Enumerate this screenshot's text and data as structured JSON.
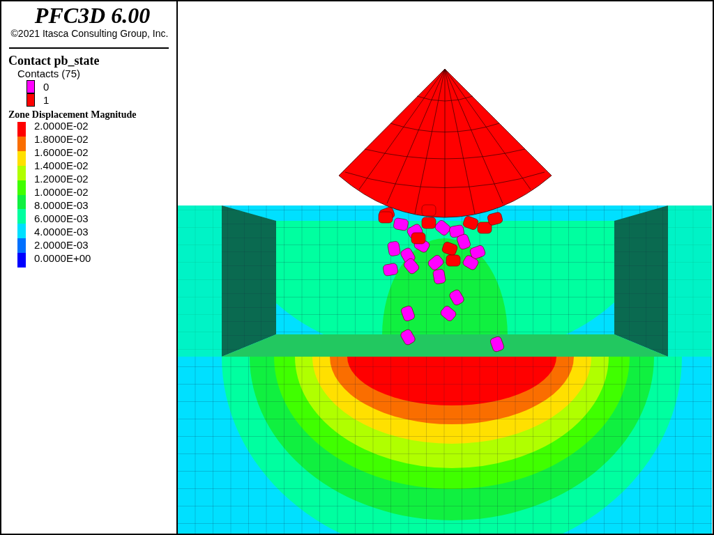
{
  "title": {
    "program": "PFC3D 6.00",
    "copyright": "©2021 Itasca Consulting Group, Inc."
  },
  "contact_legend": {
    "title": "Contact pb_state",
    "subtitle": "Contacts (75)",
    "items": [
      {
        "label": "0",
        "color": "#ff00ff"
      },
      {
        "label": "1",
        "color": "#ff0000"
      }
    ]
  },
  "zone_legend": {
    "title": "Zone Displacement Magnitude",
    "bands": [
      {
        "color": "#ff0000"
      },
      {
        "color": "#fa6e00"
      },
      {
        "color": "#ffe000"
      },
      {
        "color": "#b0ff00"
      },
      {
        "color": "#40ff00"
      },
      {
        "color": "#10f040"
      },
      {
        "color": "#00ffa0"
      },
      {
        "color": "#00e0ff"
      },
      {
        "color": "#0070ff"
      },
      {
        "color": "#0000ff"
      }
    ],
    "labels": [
      "2.0000E-02",
      "1.8000E-02",
      "1.6000E-02",
      "1.4000E-02",
      "1.2000E-02",
      "1.0000E-02",
      "8.0000E-03",
      "6.0000E-03",
      "4.0000E-03",
      "2.0000E-03",
      "0.0000E+00"
    ]
  }
}
